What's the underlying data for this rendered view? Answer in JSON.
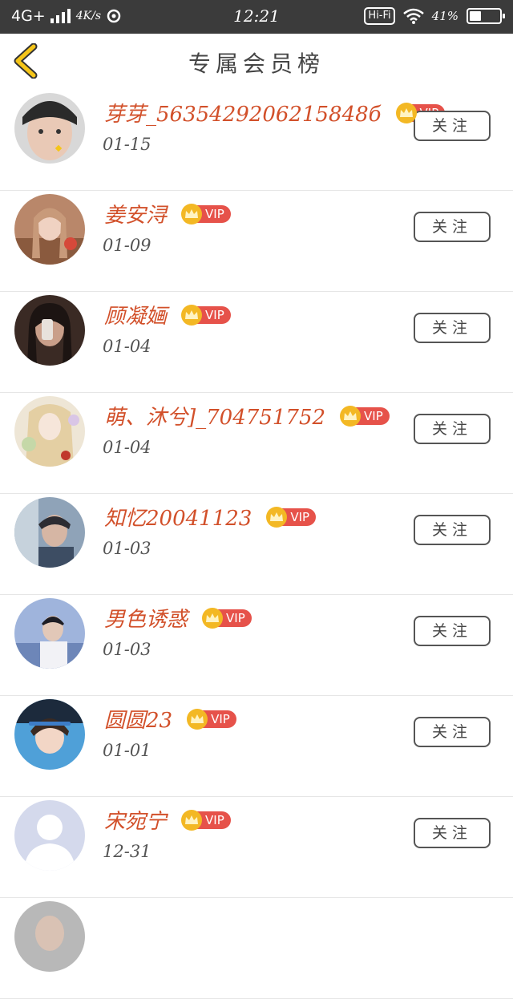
{
  "status_bar": {
    "network": "4G+",
    "speed": "4K/s",
    "time": "12:21",
    "hifi": "Hi-Fi",
    "battery": "41%"
  },
  "header": {
    "title": "专属会员榜"
  },
  "follow_label": "关注",
  "vip_label": "VIP",
  "members": [
    {
      "name": "芽芽_5635429206215848б",
      "date": "01-15"
    },
    {
      "name": "姜安浔",
      "date": "01-09"
    },
    {
      "name": "顾凝婳",
      "date": "01-04"
    },
    {
      "name": "萌、沐兮]_704751752",
      "date": "01-04"
    },
    {
      "name": "知忆20041123",
      "date": "01-03"
    },
    {
      "name": "男色诱惑",
      "date": "01-03"
    },
    {
      "name": "圆圆23",
      "date": "01-01"
    },
    {
      "name": "宋宛宁",
      "date": "12-31"
    }
  ],
  "colors": {
    "status_bar": "#3b3b3b",
    "name": "#d2502a",
    "vip_tag": "#e6524a",
    "vip_crown": "#f3b824",
    "back_arrow": "#f5c518"
  }
}
